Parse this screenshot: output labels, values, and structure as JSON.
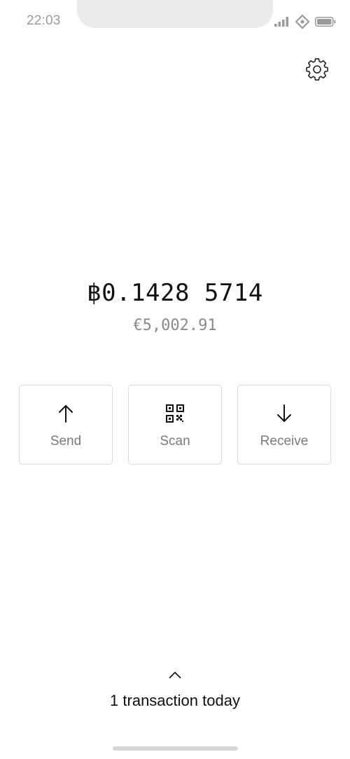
{
  "status_bar": {
    "time": "22:03",
    "icons": [
      "signal-icon",
      "location-icon",
      "battery-icon"
    ]
  },
  "header": {
    "settings_icon": "gear-icon"
  },
  "balance": {
    "btc": "฿0.1428 5714",
    "fiat": "€5,002.91"
  },
  "actions": [
    {
      "label": "Send",
      "icon": "arrow-up-icon"
    },
    {
      "label": "Scan",
      "icon": "qr-code-icon"
    },
    {
      "label": "Receive",
      "icon": "arrow-down-icon"
    }
  ],
  "transactions": {
    "summary": "1 transaction today",
    "toggle_icon": "chevron-up-icon"
  },
  "colors": {
    "text_primary": "#111111",
    "text_secondary": "#8a8a8a",
    "border": "#dcdcdc",
    "status_gray": "#9a9a9a"
  }
}
